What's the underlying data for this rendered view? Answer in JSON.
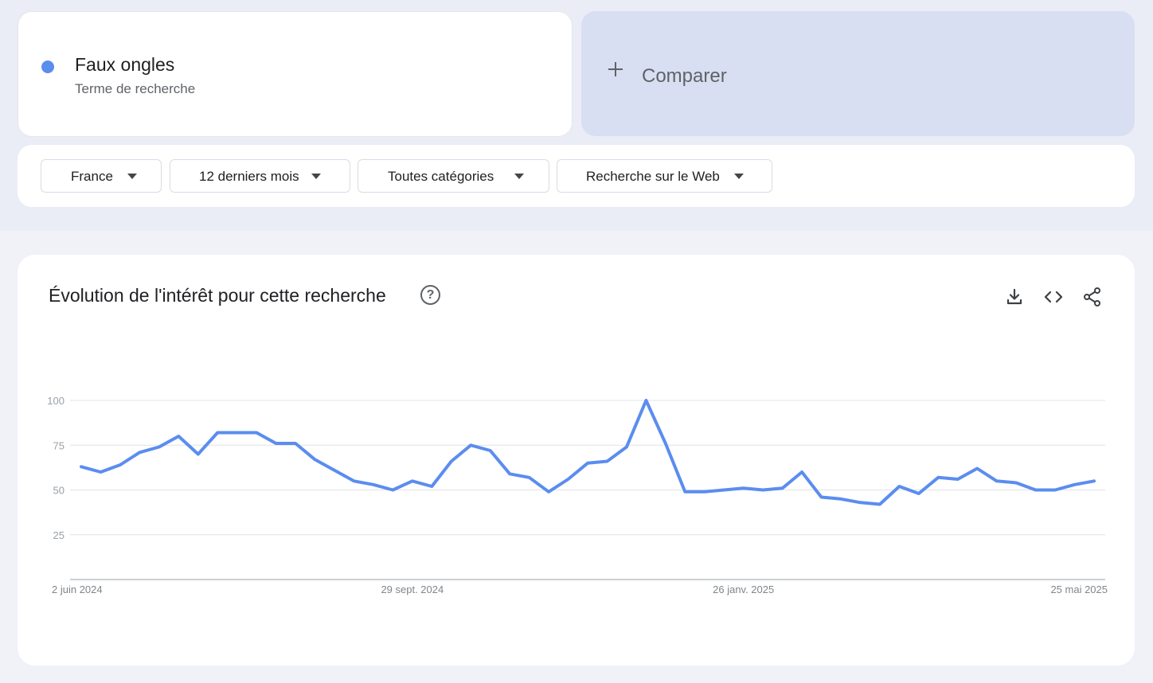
{
  "term": {
    "name": "Faux ongles",
    "type": "Terme de recherche",
    "color": "#5b8def"
  },
  "compare": {
    "label": "Comparer"
  },
  "filters": [
    {
      "label": "France"
    },
    {
      "label": "12 derniers mois"
    },
    {
      "label": "Toutes catégories"
    },
    {
      "label": "Recherche sur le Web"
    }
  ],
  "chart": {
    "title": "Évolution de l'intérêt pour cette recherche",
    "actions": [
      "download-icon",
      "embed-code-icon",
      "share-icon"
    ]
  },
  "chart_data": {
    "type": "line",
    "title": "Évolution de l'intérêt pour cette recherche",
    "xlabel": "",
    "ylabel": "",
    "ylim": [
      0,
      100
    ],
    "yticks": [
      25,
      50,
      75,
      100
    ],
    "grid": true,
    "x_tick_labels": [
      {
        "label": "2 juin 2024",
        "index": 0
      },
      {
        "label": "29 sept. 2024",
        "index": 17
      },
      {
        "label": "26 janv. 2025",
        "index": 34
      },
      {
        "label": "25 mai 2025",
        "index": 51
      }
    ],
    "series": [
      {
        "name": "Faux ongles",
        "color": "#5b8def",
        "values": [
          63,
          60,
          64,
          71,
          74,
          80,
          70,
          82,
          82,
          82,
          76,
          76,
          67,
          61,
          55,
          53,
          50,
          55,
          52,
          66,
          75,
          72,
          59,
          57,
          49,
          56,
          65,
          66,
          74,
          100,
          76,
          49,
          49,
          50,
          51,
          50,
          51,
          60,
          46,
          45,
          43,
          42,
          52,
          48,
          57,
          56,
          62,
          55,
          54,
          50,
          50,
          53,
          55
        ]
      }
    ]
  }
}
